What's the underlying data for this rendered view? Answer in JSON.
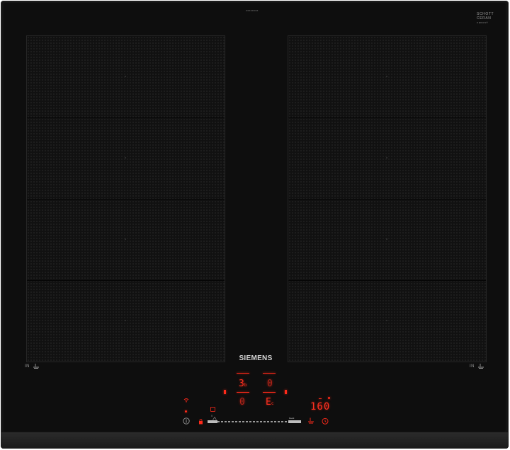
{
  "hob": {
    "brand": "SIEMENS",
    "glass_maker": [
      "SCHOTT",
      "CERAN",
      "CERAN®"
    ],
    "top_code": "XXXXXXXX",
    "zone_left_label": "IN",
    "zone_right_label": "IN"
  },
  "controls": {
    "left_zone_power": "3",
    "left_zone_power_suffix": "b",
    "left_zone_lower_display": "0",
    "right_zone_upper_display": "0",
    "right_zone_lower_display": "E",
    "right_zone_lower_suffix": "c",
    "temperature_display": "160",
    "slider_start_label": "0",
    "slider_end_label": "boost"
  },
  "colors": {
    "glass": "#0e0e0e",
    "frame": "#2b2b2b",
    "indicator_red": "#ff2a1a",
    "label_grey": "#9a9a9a"
  },
  "icons": [
    "info-icon",
    "childlock-icon",
    "wifi-icon",
    "power-icon",
    "timer-icon",
    "sensor-icon",
    "pan-icon"
  ]
}
